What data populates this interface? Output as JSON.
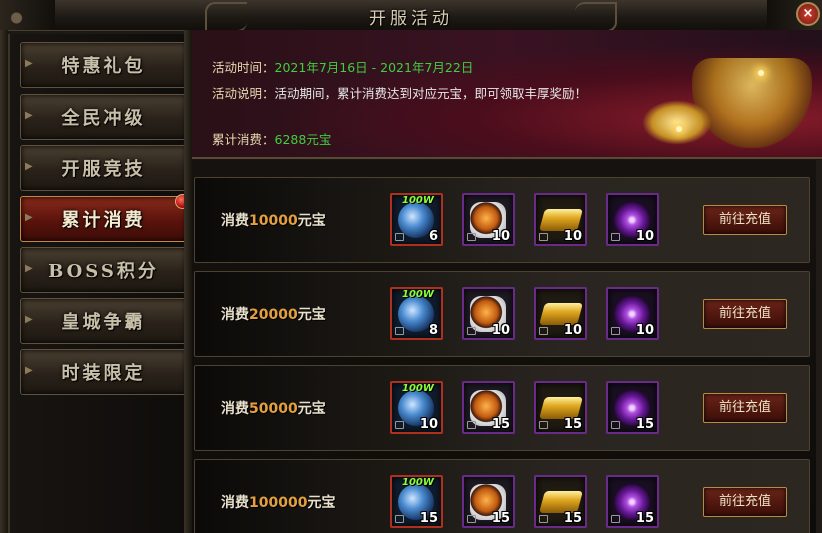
{
  "window": {
    "title": "开服活动",
    "close_label": "×"
  },
  "sidebar": {
    "items": [
      {
        "label": "特惠礼包",
        "active": false
      },
      {
        "label": "全民冲级",
        "active": false
      },
      {
        "label": "开服竞技",
        "active": false
      },
      {
        "label": "累计消费",
        "active": true
      },
      {
        "label": "BOSS积分",
        "active": false
      },
      {
        "label": "皇城争霸",
        "active": false
      },
      {
        "label": "时装限定",
        "active": false
      }
    ]
  },
  "banner": {
    "time_label": "活动时间：",
    "time_value": "2021年7月16日 - 2021年7月22日",
    "desc_label": "活动说明：",
    "desc_value": "活动期间，累计消费达到对应元宝，即可领取丰厚奖励！",
    "total_label": "累计消费：",
    "total_value": "6288元宝"
  },
  "rewards": [
    {
      "prefix": "消费",
      "amount": "10000",
      "suffix": "元宝",
      "items": [
        {
          "icon": "100w-crystal-icon",
          "tag": "100W",
          "count": "6"
        },
        {
          "icon": "orange-orb-icon",
          "count": "10"
        },
        {
          "icon": "gold-bar-icon",
          "count": "10"
        },
        {
          "icon": "purple-gem-icon",
          "count": "10"
        }
      ],
      "button": "前往充值"
    },
    {
      "prefix": "消费",
      "amount": "20000",
      "suffix": "元宝",
      "items": [
        {
          "icon": "100w-crystal-icon",
          "tag": "100W",
          "count": "8"
        },
        {
          "icon": "orange-orb-icon",
          "count": "10"
        },
        {
          "icon": "gold-bar-icon",
          "count": "10"
        },
        {
          "icon": "purple-gem-icon",
          "count": "10"
        }
      ],
      "button": "前往充值"
    },
    {
      "prefix": "消费",
      "amount": "50000",
      "suffix": "元宝",
      "items": [
        {
          "icon": "100w-crystal-icon",
          "tag": "100W",
          "count": "10"
        },
        {
          "icon": "orange-orb-icon",
          "count": "15"
        },
        {
          "icon": "gold-bar-icon",
          "count": "15"
        },
        {
          "icon": "purple-gem-icon",
          "count": "15"
        }
      ],
      "button": "前往充值"
    },
    {
      "prefix": "消费",
      "amount": "100000",
      "suffix": "元宝",
      "items": [
        {
          "icon": "100w-crystal-icon",
          "tag": "100W",
          "count": "15"
        },
        {
          "icon": "orange-orb-icon",
          "count": "15"
        },
        {
          "icon": "gold-bar-icon",
          "count": "15"
        },
        {
          "icon": "purple-gem-icon",
          "count": "15"
        }
      ],
      "button": "前往充值"
    }
  ]
}
